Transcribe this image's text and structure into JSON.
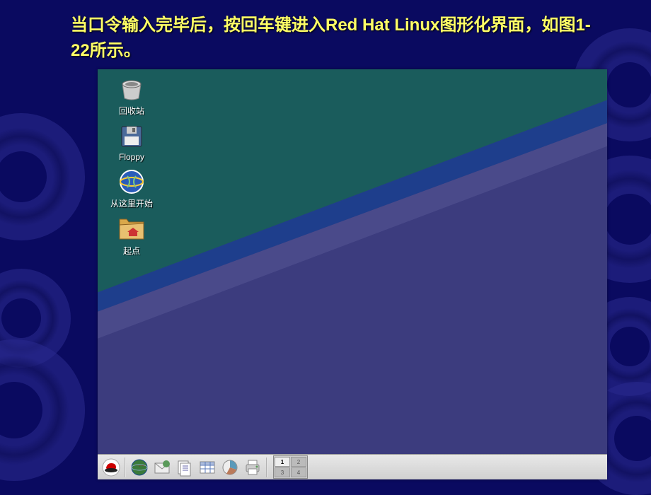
{
  "caption": "当口令输入完毕后，按回车键进入Red Hat Linux图形化界面，如图1-22所示。",
  "desktop": {
    "icons": [
      {
        "label": "回收站",
        "name": "trash-icon"
      },
      {
        "label": "Floppy",
        "name": "floppy-icon"
      },
      {
        "label": "从这里开始",
        "name": "start-here-icon"
      },
      {
        "label": "起点",
        "name": "home-folder-icon"
      }
    ]
  },
  "taskbar": {
    "icons": [
      {
        "name": "redhat-menu-icon"
      },
      {
        "name": "web-browser-icon"
      },
      {
        "name": "email-icon"
      },
      {
        "name": "documents-icon"
      },
      {
        "name": "spreadsheet-icon"
      },
      {
        "name": "presentation-icon"
      },
      {
        "name": "printer-icon"
      }
    ],
    "pager": [
      "1",
      "2",
      "3",
      "4"
    ],
    "pager_active": 0
  }
}
